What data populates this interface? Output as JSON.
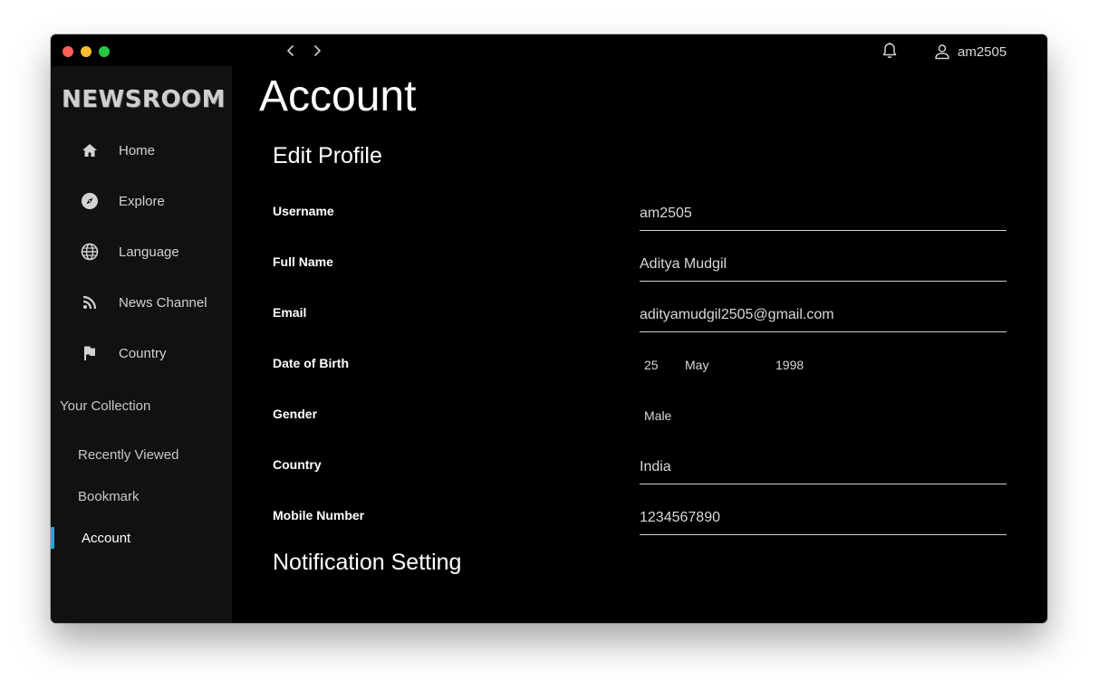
{
  "titlebar": {
    "user_name": "am2505"
  },
  "sidebar": {
    "logo": "NEWSROOM",
    "nav": [
      {
        "label": "Home",
        "icon": "home-icon"
      },
      {
        "label": "Explore",
        "icon": "compass-icon"
      },
      {
        "label": "Language",
        "icon": "globe-icon"
      },
      {
        "label": "News Channel",
        "icon": "rss-icon"
      },
      {
        "label": "Country",
        "icon": "flag-icon"
      }
    ],
    "collection_title": "Your Collection",
    "collection": [
      {
        "label": "Recently Viewed"
      },
      {
        "label": "Bookmark"
      },
      {
        "label": "Account",
        "active": true
      }
    ],
    "accent_color": "#1ea7d8"
  },
  "main": {
    "title": "Account",
    "edit_profile_title": "Edit Profile",
    "notification_title": "Notification Setting",
    "fields": {
      "username": {
        "label": "Username",
        "value": "am2505"
      },
      "full_name": {
        "label": "Full Name",
        "value": "Aditya Mudgil"
      },
      "email": {
        "label": "Email",
        "value": "adityamudgil2505@gmail.com"
      },
      "dob": {
        "label": "Date of Birth",
        "day": "25",
        "month": "May",
        "year": "1998"
      },
      "gender": {
        "label": "Gender",
        "value": "Male"
      },
      "country": {
        "label": "Country",
        "value": "India"
      },
      "mobile": {
        "label": "Mobile Number",
        "value": "1234567890"
      }
    }
  }
}
